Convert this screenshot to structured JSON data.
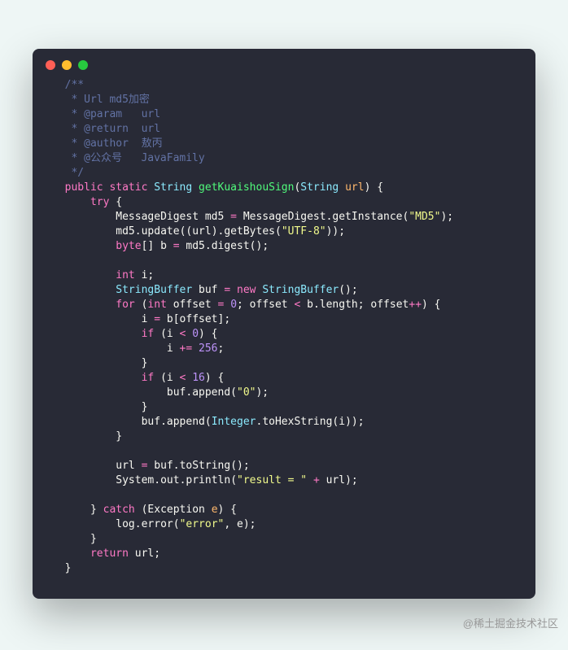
{
  "comment": {
    "l1": "  /**",
    "l2": "   * Url md5加密",
    "l3": "   * @param   url",
    "l4": "   * @return  url",
    "l5": "   * @author  敖丙",
    "l6": "   * @公众号   JavaFamily",
    "l7": "   */"
  },
  "kw": {
    "public": "public",
    "static": "static",
    "try": "try",
    "byte": "byte",
    "int": "int",
    "for": "for",
    "if": "if",
    "new": "new",
    "catch": "catch",
    "return": "return"
  },
  "type": {
    "String": "String",
    "StringBuffer": "StringBuffer",
    "Integer": "Integer"
  },
  "fn": {
    "getKuaishouSign": "getKuaishouSign"
  },
  "id": {
    "url": "url",
    "md5": "md5",
    "MessageDigest": "MessageDigest",
    "getInstance": "getInstance",
    "update": "update",
    "getBytes": "getBytes",
    "digest": "digest",
    "b": "b",
    "i": "i",
    "offset": "offset",
    "length": "length",
    "buf": "buf",
    "append": "append",
    "toHexString": "toHexString",
    "toString": "toString",
    "System": "System",
    "out": "out",
    "println": "println",
    "Exception": "Exception",
    "e": "e",
    "log": "log",
    "error": "error"
  },
  "str": {
    "MD5": "\"MD5\"",
    "UTF8": "\"UTF-8\"",
    "zero": "\"0\"",
    "result": "\"result = \"",
    "err": "\"error\""
  },
  "num": {
    "n0": "0",
    "n16": "16",
    "n256": "256"
  },
  "op": {
    "eq": "=",
    "lt": "<",
    "plus": "+",
    "pluseq": "+=",
    "plusplus": "++"
  },
  "watermark": "@稀土掘金技术社区"
}
